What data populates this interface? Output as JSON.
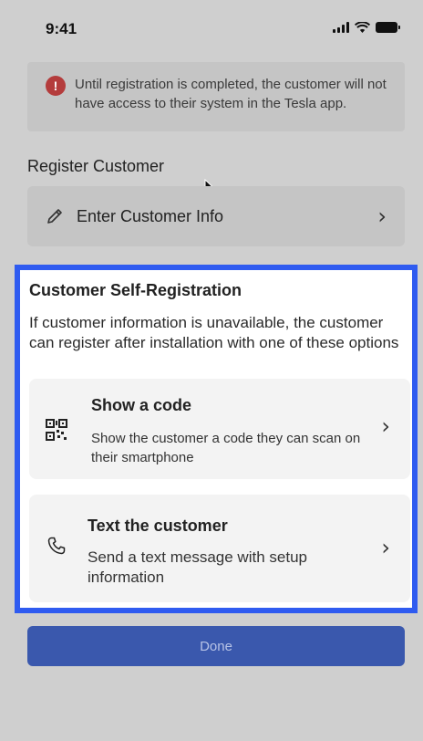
{
  "status_bar": {
    "time": "9:41",
    "icons": [
      "signal-icon",
      "wifi-icon",
      "battery-icon"
    ]
  },
  "warning": {
    "icon": "alert-icon",
    "icon_glyph": "!",
    "text": "Until registration is completed, the customer will not have access to their system in the Tesla app.",
    "color": "#b43c3c"
  },
  "register": {
    "heading": "Register Customer",
    "enter_info_label": "Enter Customer Info",
    "enter_info_icon": "pencil-icon"
  },
  "self_registration": {
    "title": "Customer Self-Registration",
    "description": "If customer information is unavailable, the customer can register after installation with one of these options",
    "highlight_color": "#2f5bf0",
    "options": [
      {
        "icon": "qr-code-icon",
        "title": "Show a code",
        "subtitle": "Show the customer a code they can scan on their smartphone"
      },
      {
        "icon": "phone-icon",
        "title": "Text the customer",
        "subtitle": "Send a text message with setup information"
      }
    ]
  },
  "done_button": {
    "label": "Done",
    "color": "#3a58ad"
  }
}
